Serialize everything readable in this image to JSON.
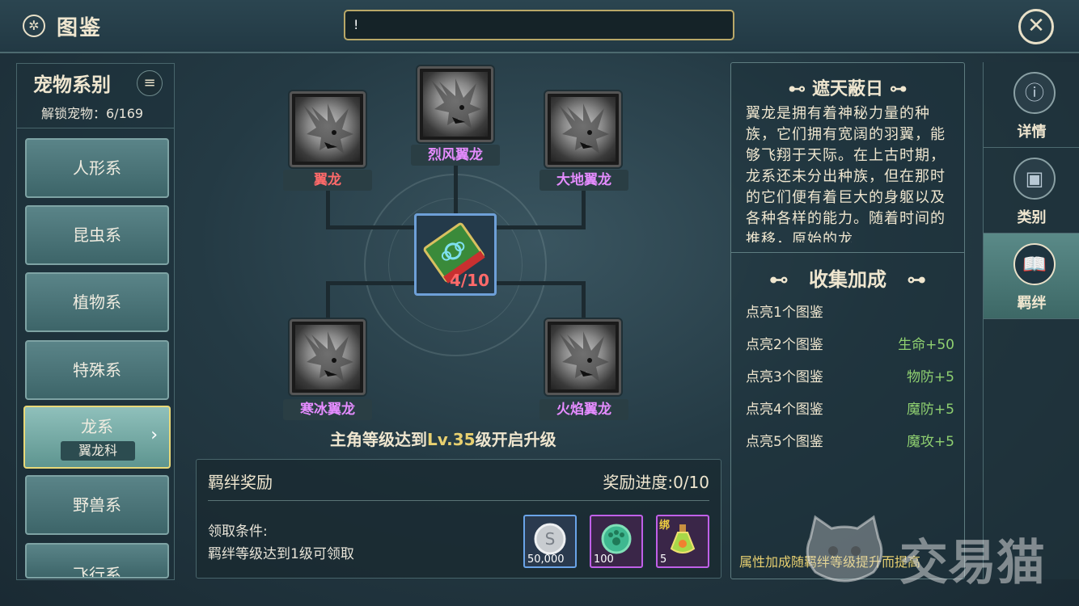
{
  "header": {
    "title": "图鉴",
    "notice": "!",
    "title_icon": "compass-icon",
    "close_icon": "close-icon"
  },
  "left_panel": {
    "title": "宠物系别",
    "unlock_label": "解锁宠物：6/169",
    "categories": [
      {
        "label": "人形系"
      },
      {
        "label": "昆虫系"
      },
      {
        "label": "植物系"
      },
      {
        "label": "特殊系"
      },
      {
        "label": "龙系",
        "sub": "翼龙科",
        "active": true
      },
      {
        "label": "野兽系"
      },
      {
        "label": "飞行系"
      }
    ]
  },
  "tree": {
    "pets": [
      {
        "name": "翼龙",
        "color": "red"
      },
      {
        "name": "烈风翼龙",
        "color": "purple"
      },
      {
        "name": "大地翼龙",
        "color": "purple"
      },
      {
        "name": "寒冰翼龙",
        "color": "purple"
      },
      {
        "name": "火焰翼龙",
        "color": "purple"
      }
    ],
    "center_count": "4/10",
    "upgrade_prefix": "主角等级达到",
    "upgrade_level": "Lv.35",
    "upgrade_suffix": "级开启升级"
  },
  "reward": {
    "title": "羁绊奖励",
    "progress": "奖励进度:0/10",
    "condition_label": "领取条件:",
    "condition_text": "羁绊等级达到1级可领取",
    "items": [
      {
        "count": "50,000",
        "icon": "silver-coin-icon",
        "rarity": "blue"
      },
      {
        "count": "100",
        "icon": "green-paw-token-icon",
        "rarity": "purple"
      },
      {
        "count": "5",
        "icon": "potion-bottle-icon",
        "rarity": "purple",
        "tag": "绑"
      }
    ]
  },
  "info": {
    "title": "遮天蔽日",
    "description": "翼龙是拥有着神秘力量的种族，它们拥有宽阔的羽翼，能够飞翔于天际。在上古时期，龙系还未分出种族，但在那时的它们便有着巨大的身躯以及各种各样的能力。随着时间的推移，原始的龙",
    "bonus_title": "收集加成",
    "bonuses": [
      {
        "label": "点亮1个图鉴",
        "value": ""
      },
      {
        "label": "点亮2个图鉴",
        "value": "生命+50"
      },
      {
        "label": "点亮3个图鉴",
        "value": "物防+5"
      },
      {
        "label": "点亮4个图鉴",
        "value": "魔防+5"
      },
      {
        "label": "点亮5个图鉴",
        "value": "魔攻+5"
      }
    ],
    "note": "属性加成随羁绊等级提升而提高"
  },
  "tabs": [
    {
      "label": "详情",
      "icon": "info-icon"
    },
    {
      "label": "类别",
      "icon": "category-book-icon"
    },
    {
      "label": "羁绊",
      "icon": "open-book-icon",
      "active": true
    }
  ],
  "watermark": "交易猫"
}
